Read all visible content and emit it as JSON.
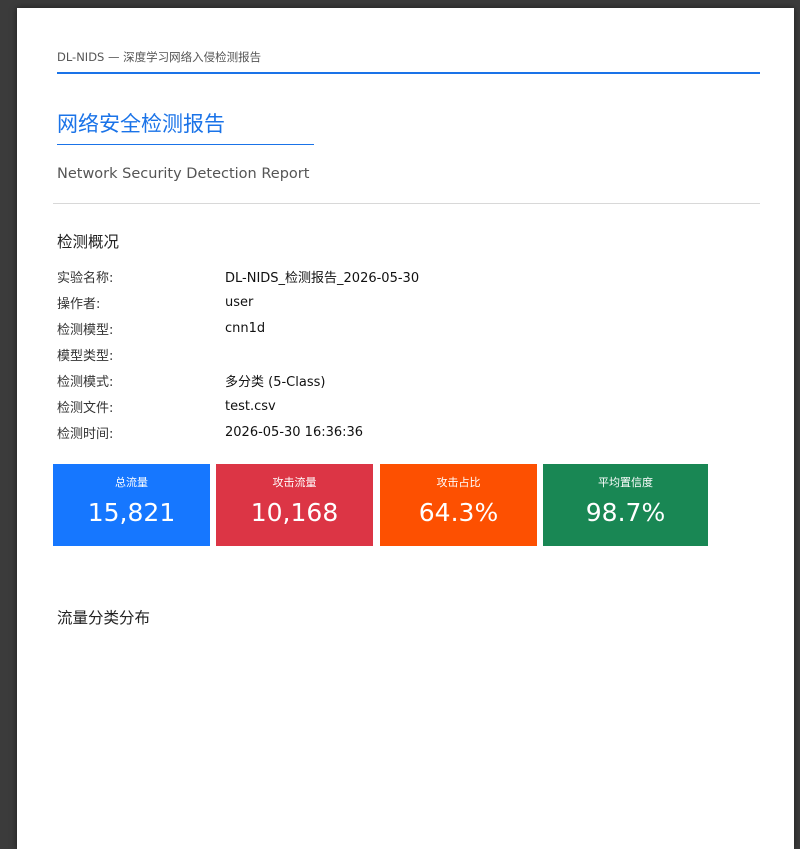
{
  "document": {
    "running_header": "DL-NIDS — 深度学习网络入侵检测报告",
    "title": "网络安全检测报告",
    "subtitle": "Network Security Detection Report"
  },
  "overview": {
    "heading": "检测概况",
    "rows": [
      {
        "label": "实验名称:",
        "value": "DL-NIDS_检测报告_2026-05-30"
      },
      {
        "label": "操作者:",
        "value": "user"
      },
      {
        "label": "检测模型:",
        "value": "cnn1d"
      },
      {
        "label": "模型类型:",
        "value": ""
      },
      {
        "label": "检测模式:",
        "value": "多分类 (5-Class)"
      },
      {
        "label": "检测文件:",
        "value": "test.csv"
      },
      {
        "label": "检测时间:",
        "value": "2026-05-30 16:36:36"
      }
    ]
  },
  "stats": [
    {
      "label": "总流量",
      "value": "15,821",
      "color": "#1677ff"
    },
    {
      "label": "攻击流量",
      "value": "10,168",
      "color": "#dc3545"
    },
    {
      "label": "攻击占比",
      "value": "64.3%",
      "color": "#fd5001"
    },
    {
      "label": "平均置信度",
      "value": "98.7%",
      "color": "#198754"
    }
  ],
  "distribution": {
    "heading": "流量分类分布"
  },
  "colors": {
    "accent": "#1a73e8",
    "viewer_background": "#3b3b3b"
  }
}
